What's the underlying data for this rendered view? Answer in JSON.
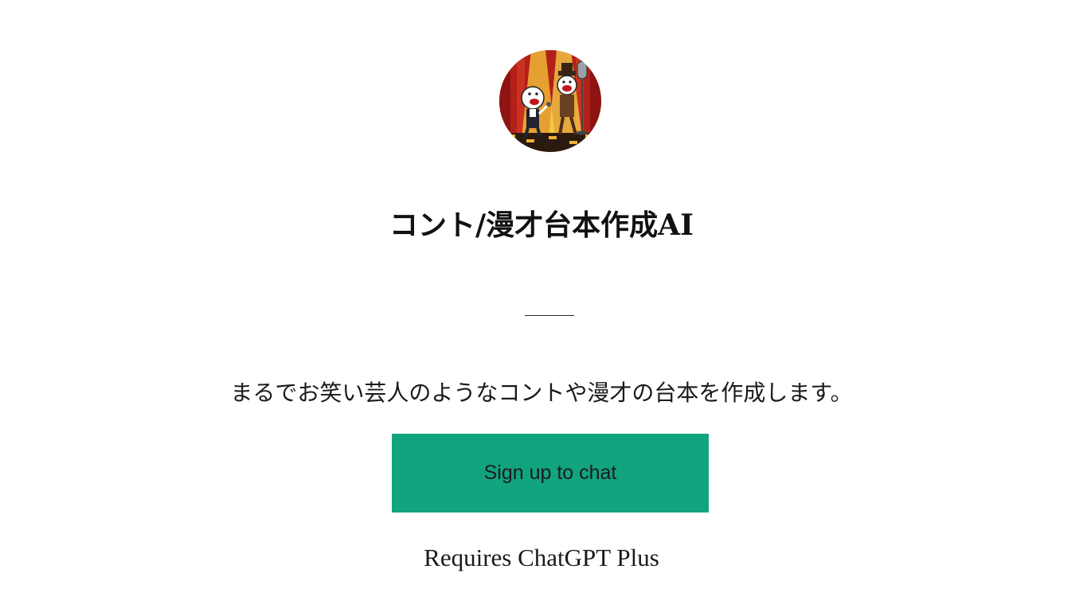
{
  "gpt": {
    "avatar_icon": "comedy-duo-stage-avatar",
    "title": "コント/漫才台本作成AI",
    "description": "まるでお笑い芸人のようなコントや漫才の台本を作成します。"
  },
  "actions": {
    "signup_label": "Sign up to chat",
    "requirement_note": "Requires ChatGPT Plus"
  },
  "colors": {
    "button": "#12a37f",
    "background": "#ffffff",
    "text": "#1a1a1a"
  }
}
